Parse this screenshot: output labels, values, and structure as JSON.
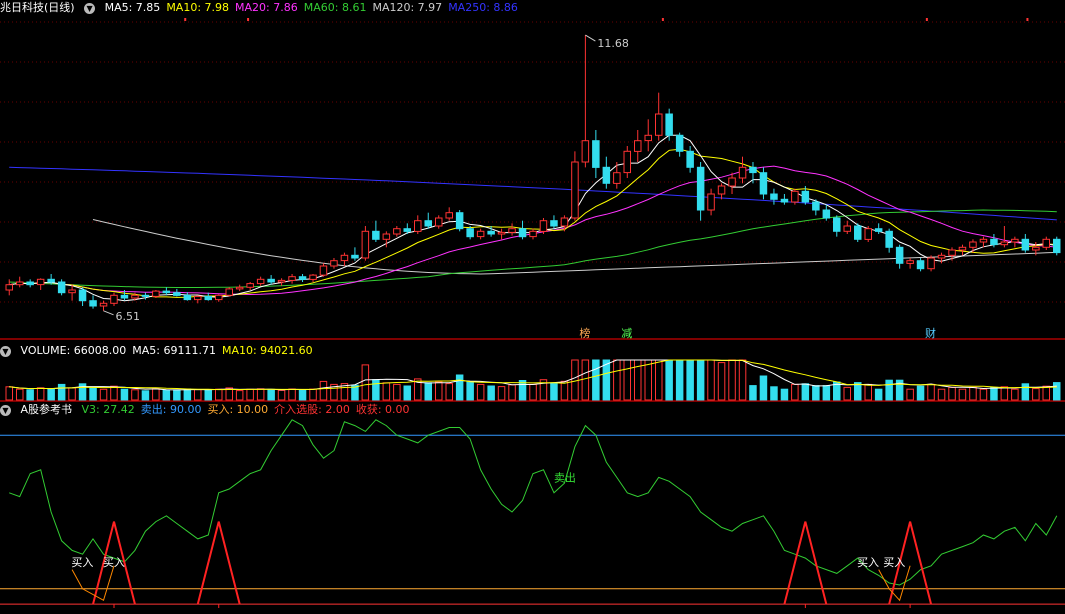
{
  "main": {
    "title": "兆日科技(日线)",
    "ma": [
      {
        "label": "MA5: 7.85",
        "color": "#ffffff"
      },
      {
        "label": "MA10: 7.98",
        "color": "#ffff00"
      },
      {
        "label": "MA20: 7.86",
        "color": "#ff33ff"
      },
      {
        "label": "MA60: 8.61",
        "color": "#33cc33"
      },
      {
        "label": "MA120: 7.97",
        "color": "#cccccc"
      },
      {
        "label": "MA250: 8.86",
        "color": "#3333ff"
      }
    ],
    "high_label": "11.68",
    "low_label": "6.51",
    "markers": [
      {
        "text": "榜",
        "color": "#ffaa55",
        "day": 55
      },
      {
        "text": "减",
        "color": "#55ff55",
        "day": 59
      },
      {
        "text": "财",
        "color": "#55ccff",
        "day": 88
      }
    ]
  },
  "volume": {
    "items": [
      {
        "label": "VOLUME: 66008.00",
        "color": "#ffffff"
      },
      {
        "label": "MA5: 69111.71",
        "color": "#ffffff"
      },
      {
        "label": "MA10: 94021.60",
        "color": "#ffff00"
      }
    ]
  },
  "indicator": {
    "title": "A股参考书",
    "items": [
      {
        "label": "V3: 27.42",
        "color": "#33cc33"
      },
      {
        "label": "卖出: 90.00",
        "color": "#3399ff"
      },
      {
        "label": "买入: 10.00",
        "color": "#ffaa33"
      },
      {
        "label": "介入选股: 2.00",
        "color": "#ff3333"
      },
      {
        "label": "收获: 0.00",
        "color": "#ff3333"
      }
    ],
    "sell_text": "卖出",
    "buy_text": "买入"
  },
  "chart_data": {
    "type": "candlestick",
    "ohlc": [
      [
        6.9,
        7.1,
        6.8,
        7.0
      ],
      [
        7.0,
        7.15,
        6.95,
        7.05
      ],
      [
        7.05,
        7.1,
        6.95,
        7.0
      ],
      [
        7.0,
        7.12,
        6.9,
        7.1
      ],
      [
        7.1,
        7.2,
        7.0,
        7.05
      ],
      [
        7.05,
        7.1,
        6.8,
        6.85
      ],
      [
        6.85,
        7.0,
        6.7,
        6.9
      ],
      [
        6.9,
        6.95,
        6.6,
        6.7
      ],
      [
        6.7,
        6.8,
        6.55,
        6.6
      ],
      [
        6.6,
        6.7,
        6.51,
        6.65
      ],
      [
        6.65,
        6.85,
        6.6,
        6.8
      ],
      [
        6.8,
        6.9,
        6.7,
        6.75
      ],
      [
        6.75,
        6.85,
        6.7,
        6.8
      ],
      [
        6.8,
        6.85,
        6.72,
        6.78
      ],
      [
        6.78,
        6.9,
        6.75,
        6.88
      ],
      [
        6.88,
        6.95,
        6.8,
        6.85
      ],
      [
        6.85,
        6.92,
        6.78,
        6.8
      ],
      [
        6.8,
        6.86,
        6.7,
        6.72
      ],
      [
        6.72,
        6.8,
        6.65,
        6.78
      ],
      [
        6.78,
        6.85,
        6.7,
        6.72
      ],
      [
        6.72,
        6.82,
        6.68,
        6.8
      ],
      [
        6.8,
        6.95,
        6.78,
        6.92
      ],
      [
        6.92,
        7.0,
        6.88,
        6.95
      ],
      [
        6.95,
        7.05,
        6.9,
        7.02
      ],
      [
        7.02,
        7.15,
        6.98,
        7.1
      ],
      [
        7.1,
        7.18,
        7.0,
        7.05
      ],
      [
        7.05,
        7.12,
        6.98,
        7.08
      ],
      [
        7.08,
        7.2,
        7.02,
        7.15
      ],
      [
        7.15,
        7.2,
        7.05,
        7.1
      ],
      [
        7.1,
        7.2,
        7.05,
        7.18
      ],
      [
        7.18,
        7.4,
        7.15,
        7.35
      ],
      [
        7.35,
        7.5,
        7.3,
        7.45
      ],
      [
        7.45,
        7.6,
        7.35,
        7.55
      ],
      [
        7.55,
        7.7,
        7.45,
        7.5
      ],
      [
        7.5,
        8.1,
        7.45,
        8.0
      ],
      [
        8.0,
        8.2,
        7.8,
        7.85
      ],
      [
        7.85,
        8.0,
        7.7,
        7.95
      ],
      [
        7.95,
        8.1,
        7.9,
        8.05
      ],
      [
        8.05,
        8.15,
        7.95,
        8.0
      ],
      [
        8.0,
        8.3,
        7.95,
        8.2
      ],
      [
        8.2,
        8.35,
        8.05,
        8.1
      ],
      [
        8.1,
        8.3,
        8.05,
        8.25
      ],
      [
        8.25,
        8.45,
        8.2,
        8.35
      ],
      [
        8.35,
        8.4,
        8.0,
        8.05
      ],
      [
        8.05,
        8.1,
        7.85,
        7.9
      ],
      [
        7.9,
        8.05,
        7.85,
        8.0
      ],
      [
        8.0,
        8.1,
        7.9,
        7.95
      ],
      [
        7.95,
        8.05,
        7.85,
        7.98
      ],
      [
        7.98,
        8.15,
        7.92,
        8.05
      ],
      [
        8.05,
        8.2,
        7.85,
        7.9
      ],
      [
        7.9,
        8.05,
        7.85,
        8.0
      ],
      [
        8.0,
        8.25,
        7.95,
        8.2
      ],
      [
        8.2,
        8.3,
        8.05,
        8.1
      ],
      [
        8.1,
        8.3,
        8.0,
        8.25
      ],
      [
        8.25,
        9.5,
        8.2,
        9.3
      ],
      [
        9.3,
        11.68,
        9.2,
        9.7
      ],
      [
        9.7,
        9.9,
        9.0,
        9.2
      ],
      [
        9.2,
        9.4,
        8.8,
        8.9
      ],
      [
        8.9,
        9.3,
        8.8,
        9.1
      ],
      [
        9.1,
        9.6,
        9.0,
        9.5
      ],
      [
        9.5,
        9.9,
        9.3,
        9.7
      ],
      [
        9.7,
        10.1,
        9.5,
        9.8
      ],
      [
        9.8,
        10.6,
        9.7,
        10.2
      ],
      [
        10.2,
        10.3,
        9.7,
        9.8
      ],
      [
        9.8,
        9.85,
        9.4,
        9.5
      ],
      [
        9.5,
        9.6,
        9.1,
        9.2
      ],
      [
        9.2,
        9.3,
        8.2,
        8.4
      ],
      [
        8.4,
        8.8,
        8.3,
        8.7
      ],
      [
        8.7,
        8.9,
        8.6,
        8.85
      ],
      [
        8.85,
        9.1,
        8.7,
        9.0
      ],
      [
        9.0,
        9.4,
        8.9,
        9.2
      ],
      [
        9.2,
        9.3,
        8.9,
        9.1
      ],
      [
        9.1,
        9.2,
        8.6,
        8.7
      ],
      [
        8.7,
        8.8,
        8.5,
        8.6
      ],
      [
        8.6,
        8.7,
        8.5,
        8.55
      ],
      [
        8.55,
        8.8,
        8.5,
        8.75
      ],
      [
        8.75,
        8.85,
        8.5,
        8.55
      ],
      [
        8.55,
        8.6,
        8.3,
        8.4
      ],
      [
        8.4,
        8.5,
        8.2,
        8.25
      ],
      [
        8.25,
        8.3,
        7.9,
        8.0
      ],
      [
        8.0,
        8.2,
        7.95,
        8.1
      ],
      [
        8.1,
        8.15,
        7.8,
        7.85
      ],
      [
        7.85,
        8.1,
        7.8,
        8.05
      ],
      [
        8.05,
        8.15,
        7.95,
        8.0
      ],
      [
        8.0,
        8.05,
        7.6,
        7.7
      ],
      [
        7.7,
        7.75,
        7.3,
        7.4
      ],
      [
        7.4,
        7.5,
        7.3,
        7.45
      ],
      [
        7.45,
        7.5,
        7.25,
        7.3
      ],
      [
        7.3,
        7.55,
        7.25,
        7.5
      ],
      [
        7.5,
        7.6,
        7.4,
        7.55
      ],
      [
        7.55,
        7.7,
        7.45,
        7.65
      ],
      [
        7.65,
        7.75,
        7.55,
        7.7
      ],
      [
        7.7,
        7.85,
        7.6,
        7.8
      ],
      [
        7.8,
        7.9,
        7.7,
        7.85
      ],
      [
        7.85,
        7.95,
        7.7,
        7.75
      ],
      [
        7.75,
        8.1,
        7.7,
        7.8
      ],
      [
        7.8,
        7.9,
        7.7,
        7.85
      ],
      [
        7.85,
        7.95,
        7.6,
        7.65
      ],
      [
        7.65,
        7.8,
        7.55,
        7.7
      ],
      [
        7.7,
        7.9,
        7.65,
        7.85
      ],
      [
        7.85,
        7.9,
        7.55,
        7.6
      ]
    ],
    "ylim": [
      6.3,
      12.0
    ]
  }
}
